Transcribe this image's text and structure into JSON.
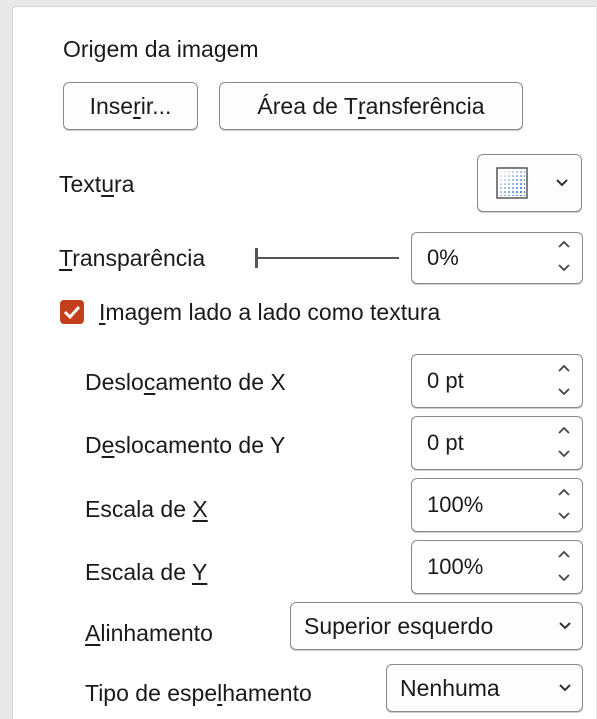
{
  "image_source": {
    "heading_parts": [
      "Origem da imagem"
    ],
    "insert_button_parts": [
      "Inse",
      "r",
      "ir..."
    ],
    "clipboard_button_parts": [
      "Área de T",
      "r",
      "ansferência"
    ]
  },
  "texture": {
    "label_parts": [
      "Text",
      "u",
      "ra"
    ],
    "icon": "texture-swatch-icon",
    "dropdown_icon": "chevron-down-icon"
  },
  "transparency": {
    "label_parts": [
      "",
      "T",
      "ransparência"
    ],
    "value": "0%",
    "slider_level": 0
  },
  "tile_checkbox": {
    "checked": true,
    "label_parts": [
      "",
      "I",
      "magem lado a lado como textura"
    ],
    "accent_color": "#c43e1c"
  },
  "offset_x": {
    "label_parts": [
      "Deslo",
      "c",
      "amento de X"
    ],
    "value": "0 pt"
  },
  "offset_y": {
    "label_parts": [
      "D",
      "e",
      "slocamento de Y"
    ],
    "value": "0 pt"
  },
  "scale_x": {
    "label_parts": [
      "Escala de ",
      "X",
      ""
    ],
    "value": "100%"
  },
  "scale_y": {
    "label_parts": [
      "Escala de ",
      "Y",
      ""
    ],
    "value": "100%"
  },
  "alignment": {
    "label_parts": [
      "",
      "A",
      "linhamento"
    ],
    "value": "Superior esquerdo"
  },
  "mirror": {
    "label_parts": [
      "Tipo de espe",
      "l",
      "hamento"
    ],
    "value": "Nenhuma"
  }
}
